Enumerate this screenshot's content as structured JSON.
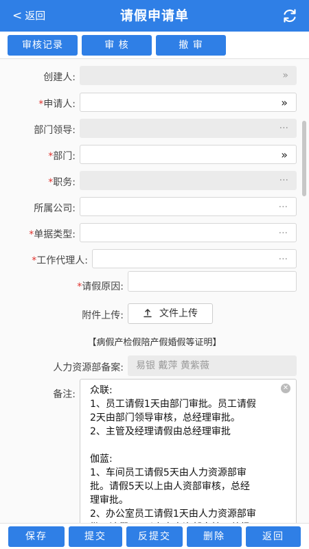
{
  "header": {
    "back_label": "返回",
    "title": "请假申请单"
  },
  "toolbar": {
    "record_label": "审核记录",
    "audit_label": "审 核",
    "withdraw_label": "撤 审"
  },
  "form": {
    "creator": {
      "label": "创建人:",
      "tail": "»"
    },
    "applicant": {
      "label": "申请人:",
      "tail": "»"
    },
    "dept_leader": {
      "label": "部门领导:",
      "tail": "···"
    },
    "department": {
      "label": "部门:",
      "tail": "»"
    },
    "position": {
      "label": "职务:",
      "tail": "···"
    },
    "company": {
      "label": "所属公司:",
      "tail": "···"
    },
    "doc_type": {
      "label": "单据类型:",
      "tail": "···"
    },
    "agent": {
      "label": "工作代理人:",
      "tail": "···"
    },
    "reason": {
      "label": "请假原因:"
    },
    "attachment": {
      "label": "附件上传:",
      "button": "文件上传"
    },
    "hint": "【病假产检假陪产假婚假等证明】",
    "hr": {
      "label": "人力资源部备案:",
      "value": "易银 戴萍 黄紫薇"
    },
    "remark": {
      "label": "备注:",
      "lines": [
        "众联:",
        "1、员工请假1天由部门审批。员工请假",
        "2天由部门领导审核，总经理审批。",
        "2、主管及经理请假由总经理审批",
        "",
        "伽蓝:",
        "1、车间员工请假5天由人力资源部审",
        "批。请假5天以上由人资部审核，总经",
        "理审批。",
        "2、办公室员工请假1天由人力资源部审",
        "批。请假2天以上由人资部审核，总经"
      ]
    }
  },
  "bottom": {
    "save": "保存",
    "submit": "提交",
    "unsubmit": "反提交",
    "delete": "删除",
    "back": "返回"
  }
}
